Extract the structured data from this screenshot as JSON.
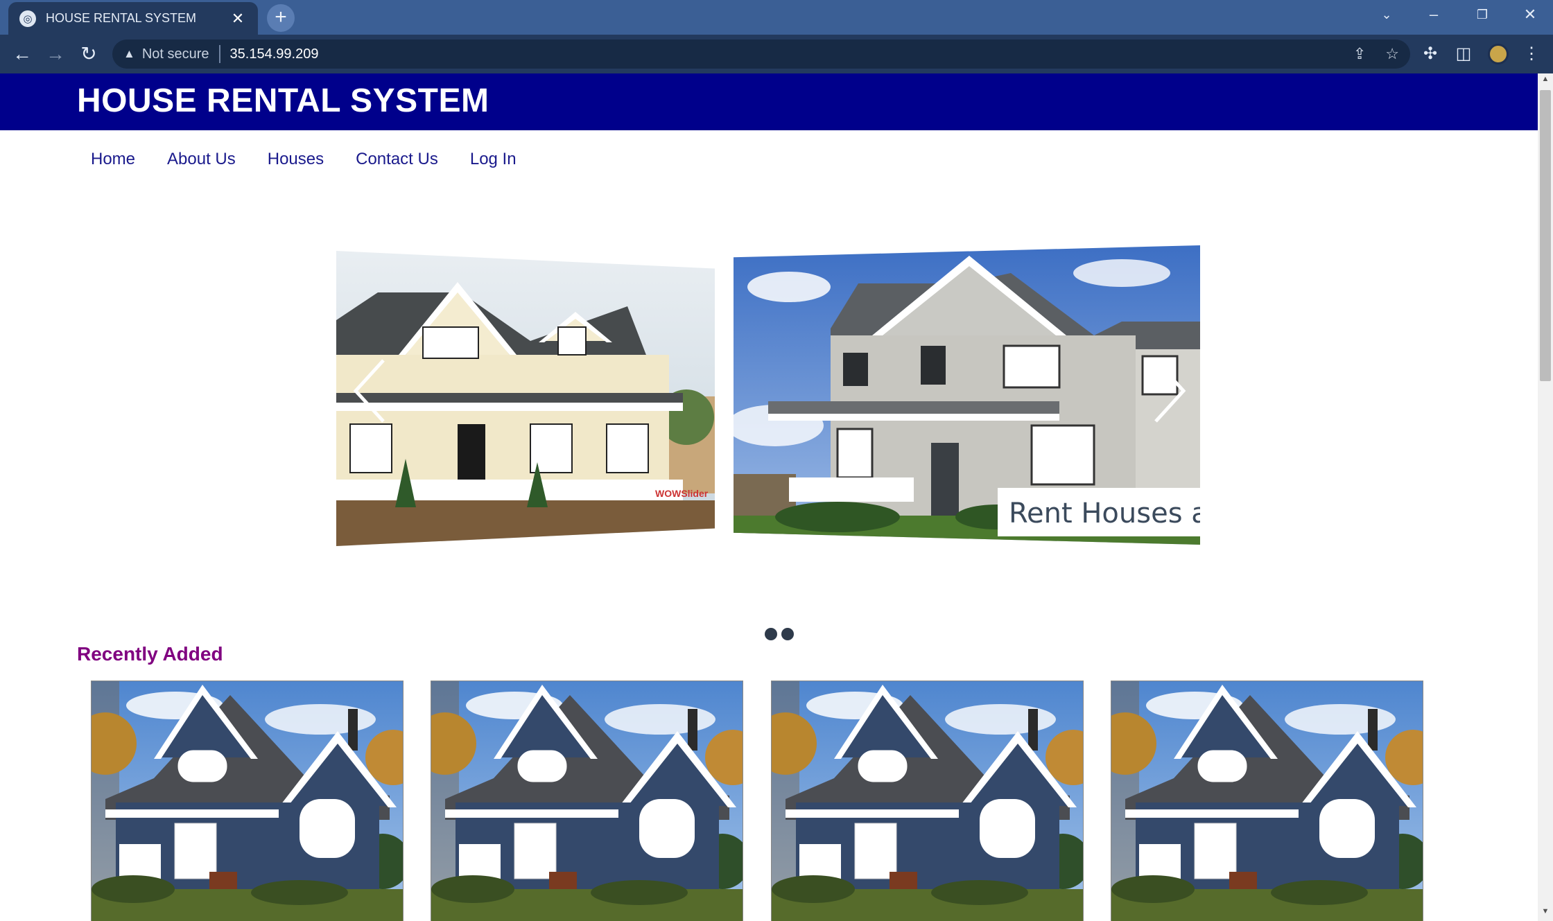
{
  "browser": {
    "tab_title": "HOUSE RENTAL SYSTEM",
    "security_label": "Not secure",
    "url": "35.154.99.209"
  },
  "site": {
    "title": "HOUSE RENTAL SYSTEM",
    "nav": [
      "Home",
      "About Us",
      "Houses",
      "Contact Us",
      "Log In"
    ]
  },
  "slider": {
    "caption": "Rent Houses a",
    "watermark": "WOWSlider",
    "dot_count": 2
  },
  "recent": {
    "title": "Recently Added",
    "card_count": 4
  },
  "colors": {
    "header_bg": "#00008b",
    "nav_link": "#1a1a8c",
    "section_title": "#800080"
  }
}
